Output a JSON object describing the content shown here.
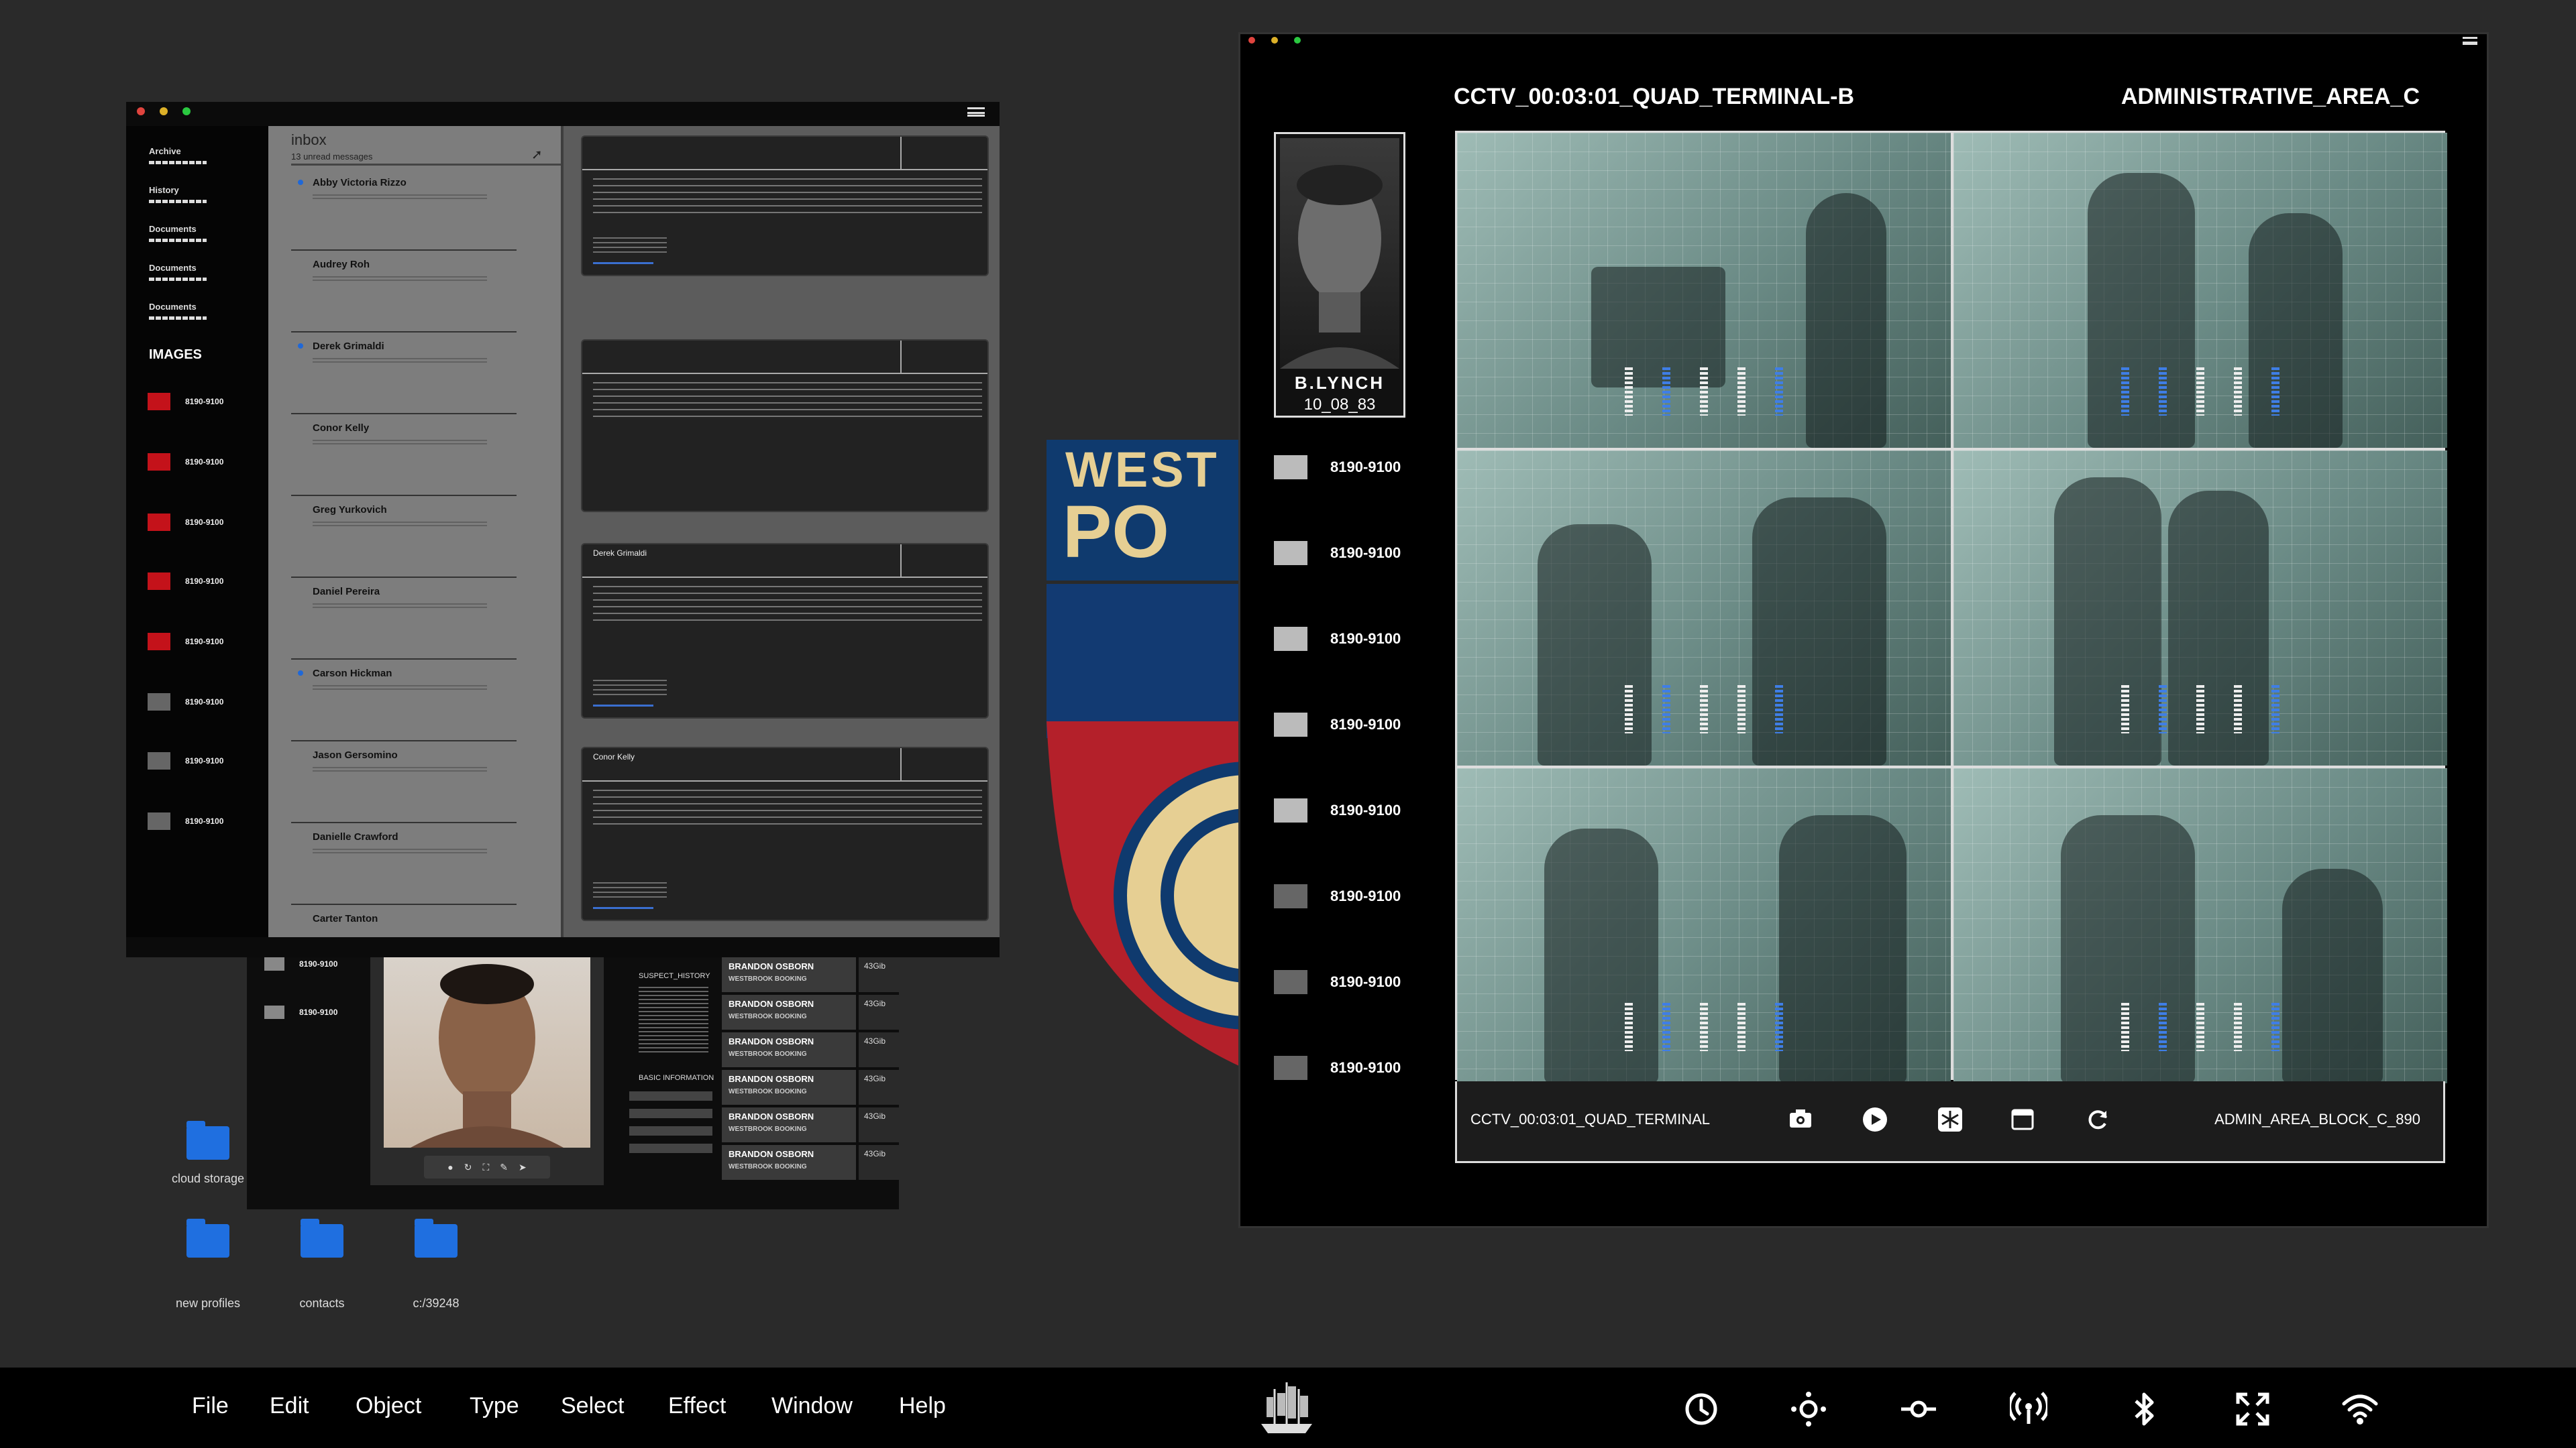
{
  "mail": {
    "inbox_title": "inbox",
    "unread": "13 unread messages",
    "sidebar_links": [
      "Archive",
      "History",
      "Documents",
      "Documents",
      "Documents"
    ],
    "images_heading": "IMAGES",
    "image_folders": [
      "8190-9100",
      "8190-9100",
      "8190-9100",
      "8190-9100",
      "8190-9100",
      "8190-9100",
      "8190-9100",
      "8190-9100"
    ],
    "messages": [
      "Abby Victoria Rizzo",
      "Audrey Roh",
      "Derek Grimaldi",
      "Conor Kelly",
      "Greg Yurkovich",
      "Daniel Pereira",
      "Carson Hickman",
      "Jason Gersomino",
      "Danielle Crawford",
      "Carter Tanton"
    ],
    "cards": [
      "",
      "",
      "Derek Grimaldi",
      "Conor Kelly"
    ]
  },
  "profile": {
    "folders": [
      "8190-9100",
      "8190-9100"
    ],
    "section1": "SUSPECT_HISTORY",
    "section2": "BASIC INFORMATION",
    "records": [
      {
        "name": "BRANDON OSBORN",
        "sub": "WESTBROOK BOOKING",
        "size": "43Gib"
      },
      {
        "name": "BRANDON OSBORN",
        "sub": "WESTBROOK BOOKING",
        "size": "43Gib"
      },
      {
        "name": "BRANDON OSBORN",
        "sub": "WESTBROOK BOOKING",
        "size": "43Gib"
      },
      {
        "name": "BRANDON OSBORN",
        "sub": "WESTBROOK BOOKING",
        "size": "43Gib"
      },
      {
        "name": "BRANDON OSBORN",
        "sub": "WESTBROOK BOOKING",
        "size": "43Gib"
      },
      {
        "name": "BRANDON OSBORN",
        "sub": "WESTBROOK BOOKING",
        "size": "43Gib"
      }
    ]
  },
  "desktop": [
    "cloud storage",
    "new profiles",
    "contacts",
    "c:/39248"
  ],
  "badge": {
    "line1": "WEST",
    "line2": "PO"
  },
  "cctv": {
    "title_left": "CCTV_00:03:01_QUAD_TERMINAL-B",
    "title_right": "ADMINISTRATIVE_AREA_C",
    "suspect_name": "B.LYNCH",
    "suspect_date": "10_08_83",
    "folders": [
      "8190-9100",
      "8190-9100",
      "8190-9100",
      "8190-9100",
      "8190-9100",
      "8190-9100",
      "8190-9100",
      "8190-9100"
    ],
    "bottom_left": "CCTV_00:03:01_QUAD_TERMINAL",
    "bottom_right": "ADMIN_AREA_BLOCK_C_890"
  },
  "taskbar": {
    "menu": [
      "File",
      "Edit",
      "Object",
      "Type",
      "Select",
      "Effect",
      "Window",
      "Help"
    ]
  },
  "colors": {
    "accent_blue": "#1f6fe0",
    "folder_red": "#c4121a",
    "traffic_red": "#e0443e",
    "traffic_yellow": "#dcb028",
    "traffic_green": "#2ac840"
  }
}
